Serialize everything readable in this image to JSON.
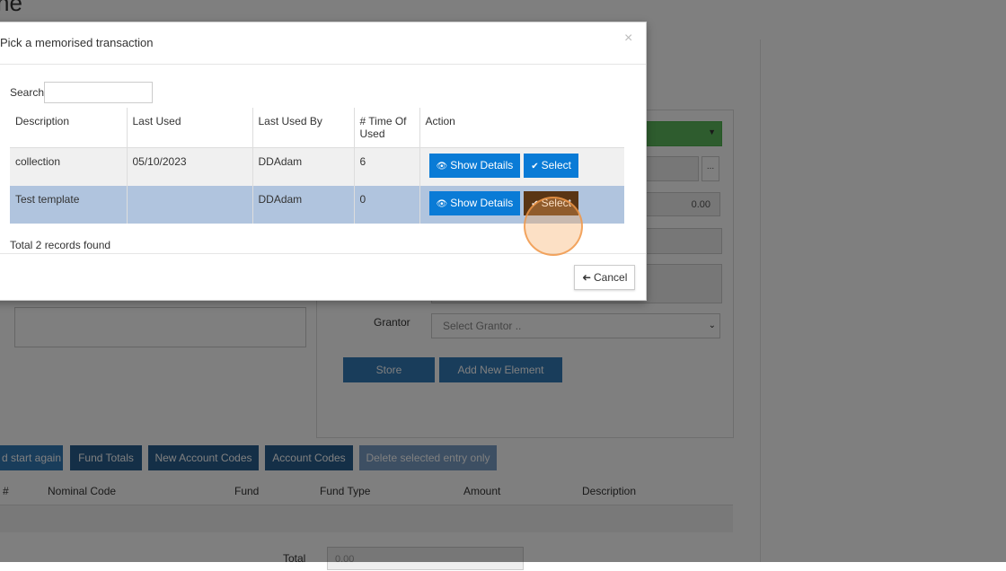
{
  "page": {
    "title": "ne"
  },
  "background_form": {
    "amount_value": "0.00",
    "grantor_label": "Grantor",
    "grantor_select": "Select Grantor ..",
    "store_button": "Store",
    "add_new_element_button": "Add New Element",
    "small_button": "..."
  },
  "background_toolbar": {
    "start_again": "d start again",
    "fund_totals": "Fund Totals",
    "new_account_codes": "New Account Codes",
    "account_codes": "Account Codes",
    "delete_selected": "Delete selected entry only"
  },
  "background_table": {
    "columns": [
      "#",
      "Nominal Code",
      "Fund",
      "Fund Type",
      "Amount",
      "Description"
    ],
    "total_label": "Total",
    "total_value": "0.00"
  },
  "modal": {
    "title": "Pick a memorised transaction",
    "close": "×",
    "search_label": "Search:",
    "search_value": "",
    "columns": {
      "description": "Description",
      "last_used": "Last Used",
      "last_used_by": "Last Used By",
      "times_used": "# Time Of Used",
      "action": "Action"
    },
    "rows": [
      {
        "description": "collection",
        "last_used": "05/10/2023",
        "last_used_by": "DDAdam",
        "times_used": "6"
      },
      {
        "description": "Test template",
        "last_used": "",
        "last_used_by": "DDAdam",
        "times_used": "0"
      }
    ],
    "show_details_label": "Show Details",
    "select_label": "Select",
    "total_records": "Total 2 records found",
    "cancel_label": "Cancel"
  },
  "icons": {
    "eye": "eye-icon",
    "check": "check-icon",
    "cancel": "arrow-circle-left-icon"
  },
  "colors": {
    "action_button": "#0a7bd6",
    "selected_row": "#b0c4de",
    "active_select_button": "#5a3514",
    "click_highlight": "#f5a65a"
  }
}
